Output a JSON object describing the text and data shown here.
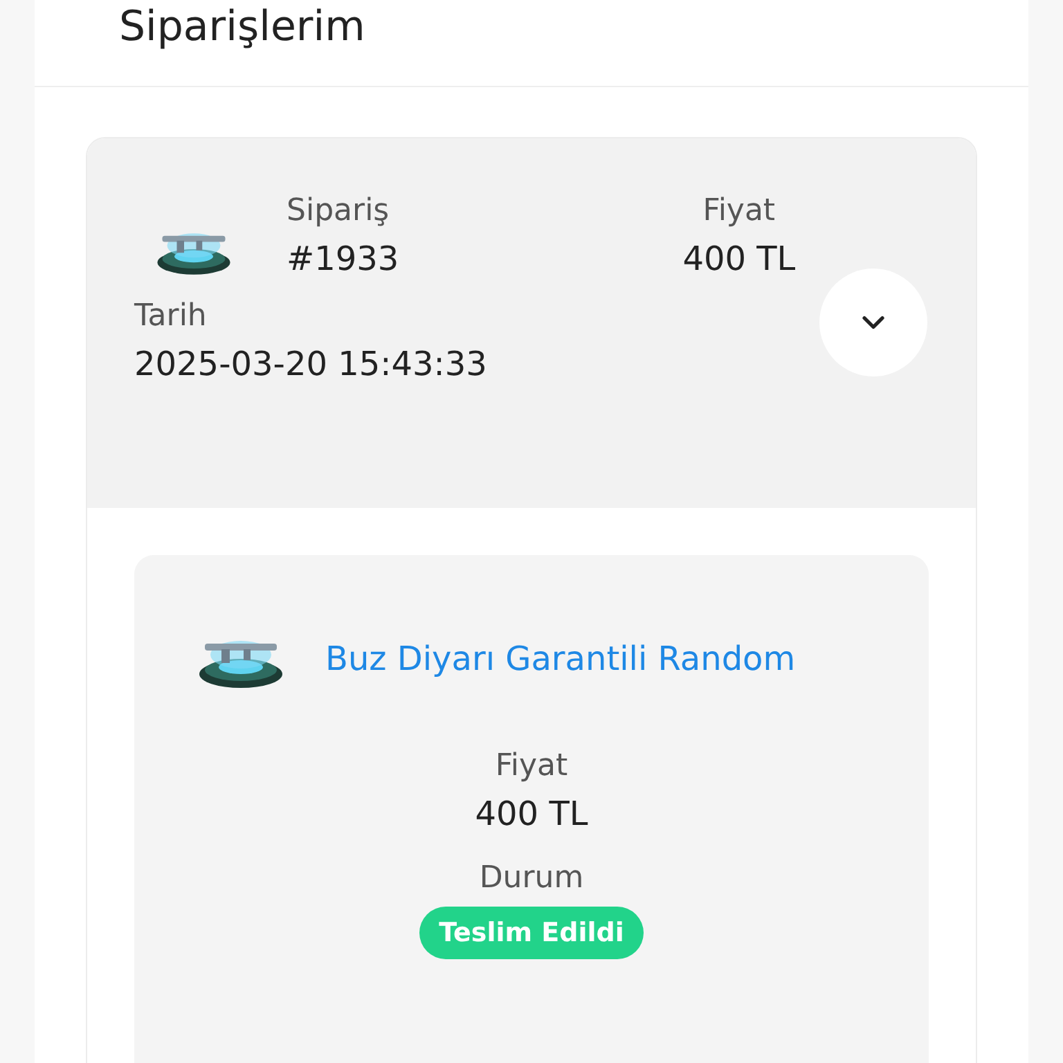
{
  "page": {
    "title": "Siparişlerim"
  },
  "order": {
    "order_label": "Sipariş",
    "order_number": "#1933",
    "price_label": "Fiyat",
    "price": "400 TL",
    "date_label": "Tarih",
    "date": "2025-03-20 15:43:33",
    "expanded": true,
    "items": [
      {
        "name": "Buz Diyarı Garantili Random",
        "price_label": "Fiyat",
        "price": "400 TL",
        "status_label": "Durum",
        "status": "Teslim Edildi",
        "color": "#22d38a"
      }
    ]
  }
}
